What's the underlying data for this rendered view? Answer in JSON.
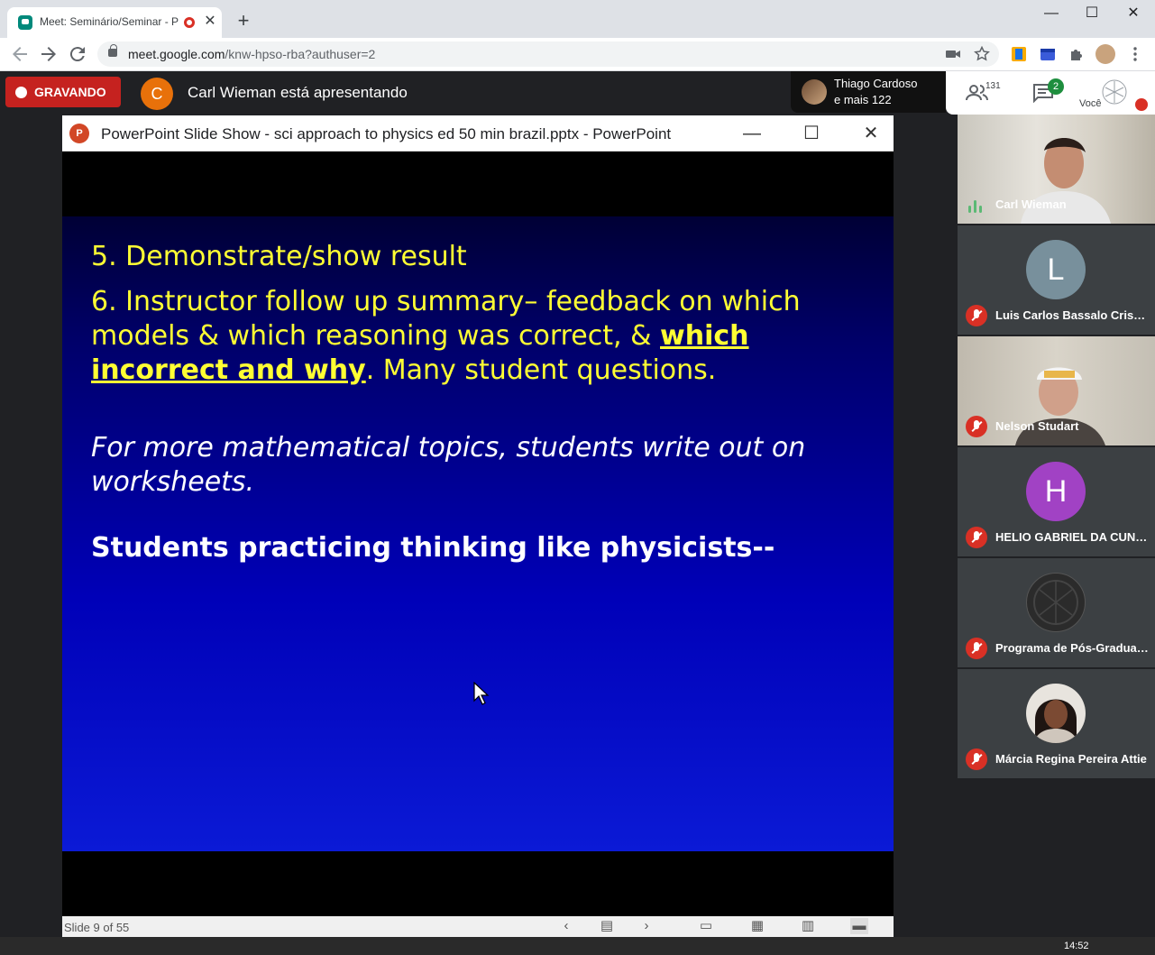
{
  "browser": {
    "tab_title": "Meet: Seminário/Seminar - P",
    "tab_close": "✕",
    "new_tab": "+",
    "window_min": "—",
    "window_max": "☐",
    "window_close": "✕",
    "url_host": "meet.google.com",
    "url_path": "/knw-hpso-rba?authuser=2"
  },
  "meet": {
    "recording_label": "GRAVANDO",
    "presenter_initial": "C",
    "presenting_text": "Carl Wieman está apresentando",
    "chip_line1": "Thiago Cardoso",
    "chip_line2": "e mais 122",
    "participants_count": "131",
    "chat_badge": "2",
    "self_label": "Você"
  },
  "powerpoint": {
    "logo": "P",
    "window_title": "PowerPoint Slide Show  -  sci approach to physics ed 50 min brazil.pptx - PowerPoint",
    "min": "—",
    "max": "☐",
    "close": "✕",
    "slide_counter": "Slide 9 of 55",
    "slide": {
      "item5": "5. Demonstrate/show result",
      "item6_a": "6. Instructor follow up summary– feedback on which models & which reasoning was correct, & ",
      "item6_b": "which incorrect and why",
      "item6_c": ". Many student questions.",
      "math_note": "For more mathematical topics, students write out on worksheets.",
      "physicists": "Students practicing thinking like physicists--"
    }
  },
  "participants": [
    {
      "name": "Carl Wieman",
      "type": "video",
      "muted": false
    },
    {
      "name": "Luis Carlos Bassalo Crispi...",
      "initial": "L",
      "color": "#78909c",
      "muted": true
    },
    {
      "name": "Nelson Studart",
      "type": "video",
      "muted": true
    },
    {
      "name": "HELIO GABRIEL DA CUNH...",
      "initial": "H",
      "color": "#a142c4",
      "muted": true
    },
    {
      "name": "Programa de Pós-Graduaç...",
      "initial": "",
      "color": "#2b2b2b",
      "muted": true
    },
    {
      "name": "Márcia Regina Pereira Attie",
      "initial": "",
      "color": "#8d6e63",
      "muted": true
    }
  ],
  "taskbar": {
    "clock": "14:52"
  }
}
